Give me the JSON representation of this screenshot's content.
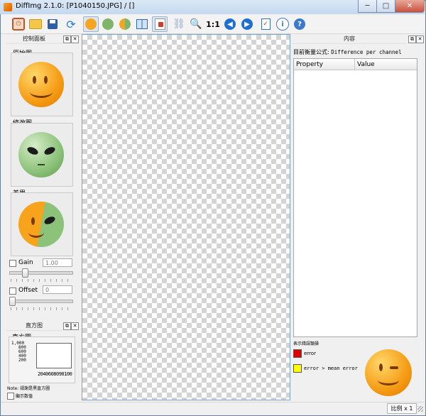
{
  "window": {
    "title": "DiffImg 2.1.0: [P1040150.JPG] / []",
    "minimize": "─",
    "maximize": "□",
    "close": "✕"
  },
  "toolbar": {
    "icons": [
      "quit-icon",
      "open-folder-icon",
      "save-icon",
      "refresh-icon",
      "original-image-icon",
      "modified-image-icon",
      "difference-image-icon",
      "dual-panel-icon",
      "mask-icon",
      "links-icon",
      "zoom-icon",
      "zoom-1to1-icon",
      "previous-icon",
      "next-icon",
      "checklist-icon",
      "info-icon",
      "help-icon"
    ],
    "zoom_1to1_label": "1:1"
  },
  "left_dock": {
    "title": "控制面板",
    "original_label": "原始图",
    "modified_label": "修改图",
    "difference_label": "差異",
    "gain_label": "Gain",
    "gain_value": "1.00",
    "offset_label": "Offset",
    "offset_value": "0"
  },
  "histogram_dock": {
    "title": "直方图",
    "group_label": "直方圖",
    "y_ticks": [
      "1,000",
      "800",
      "600",
      "400",
      "200"
    ],
    "x_ticks": "2040608090100",
    "note": "Note: 规謝是黑直方圖",
    "show_values_label": "顯示数值"
  },
  "right_dock": {
    "title": "内容",
    "metric_label": "目前衡量公式:",
    "metric_value": "Difference per channel",
    "columns": [
      "Property",
      "Value"
    ],
    "show_error_label": "表示錯誤類操",
    "legend": [
      {
        "label": "error",
        "color": "#e00000"
      },
      {
        "label": "error > mean error",
        "color": "#ffff00"
      }
    ]
  },
  "statusbar": {
    "scale": "比例 x 1"
  }
}
